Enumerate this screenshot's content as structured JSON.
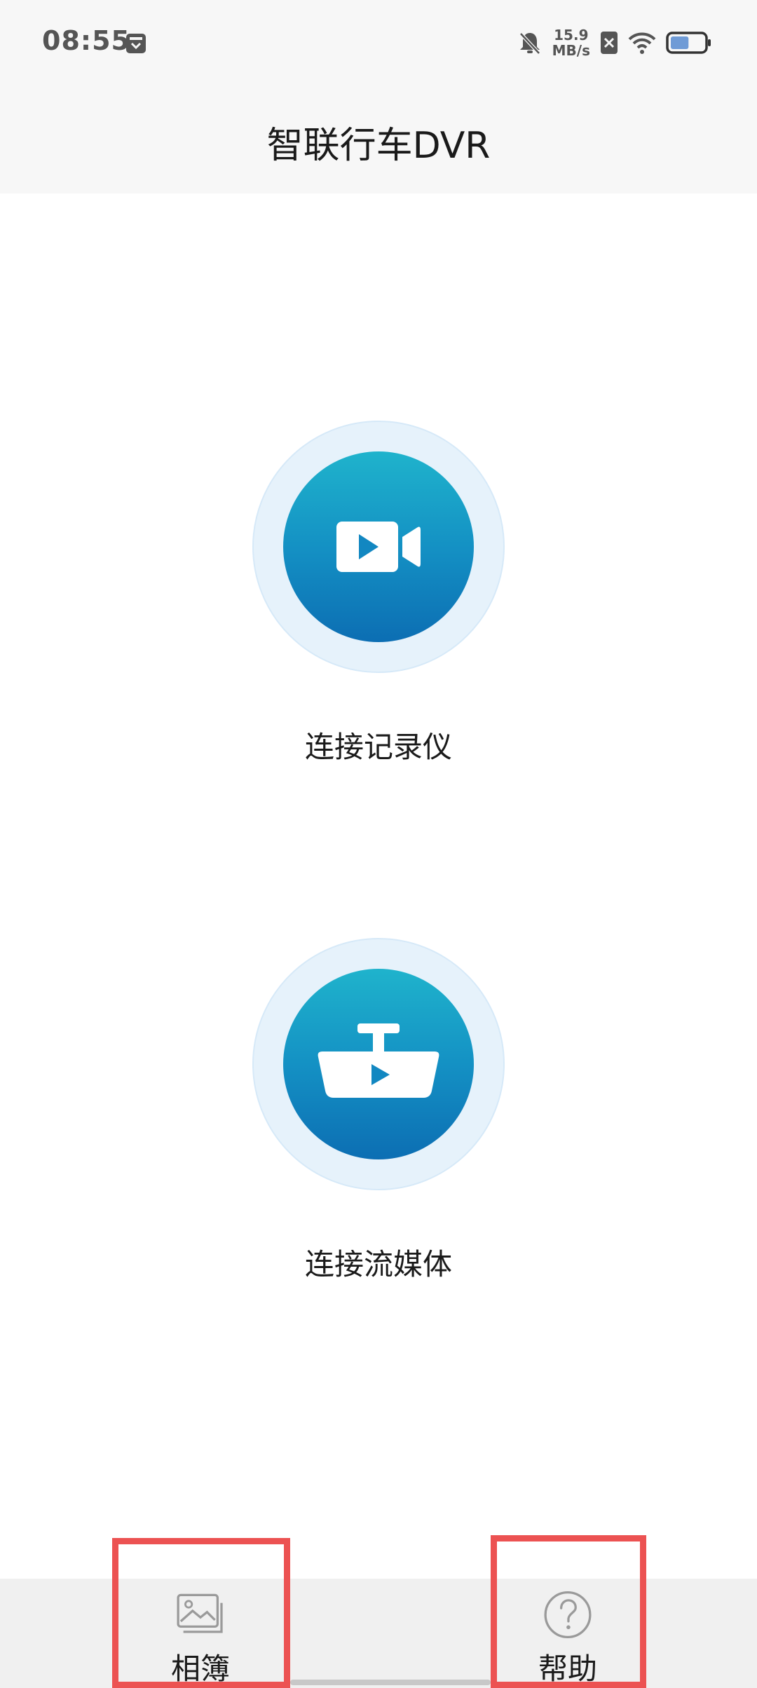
{
  "status_bar": {
    "time": "08:55",
    "net_speed_value": "15.9",
    "net_speed_unit": "MB/s",
    "battery_level": 0.55,
    "icons": [
      "app-notification-icon",
      "mute-bell-icon",
      "sim-no-signal-icon",
      "wifi-icon",
      "battery-icon"
    ]
  },
  "header": {
    "title": "智联行车DVR"
  },
  "actions": [
    {
      "label": "连接记录仪",
      "icon": "video-camera-icon"
    },
    {
      "label": "连接流媒体",
      "icon": "rearview-mirror-icon"
    }
  ],
  "bottom_nav": {
    "items": [
      {
        "label": "相簿",
        "icon": "image-gallery-icon"
      },
      {
        "label": "帮助",
        "icon": "help-circle-icon"
      }
    ]
  },
  "colors": {
    "accent_top": "#1fb3cc",
    "accent_bottom": "#0c6eb3",
    "ring": "#e6f2fb",
    "highlight": "#ec5252"
  }
}
